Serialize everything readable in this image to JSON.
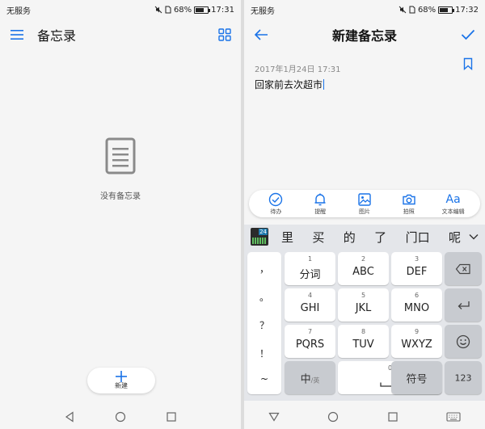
{
  "left_screen": {
    "status": {
      "carrier": "无服务",
      "battery_text": "68%",
      "battery_level": 0.68,
      "time": "17:31"
    },
    "appbar": {
      "title": "备忘录"
    },
    "empty": {
      "text": "没有备忘录"
    },
    "fab": {
      "label": "新建"
    }
  },
  "right_screen": {
    "status": {
      "carrier": "无服务",
      "battery_text": "68%",
      "battery_level": 0.68,
      "time": "17:32"
    },
    "appbar": {
      "title": "新建备忘录"
    },
    "note": {
      "date": "2017年1月24日 17:31",
      "body": "回家前去次超市"
    },
    "toolbar": {
      "items": [
        {
          "label": "待办",
          "icon": "check-circle-icon"
        },
        {
          "label": "提醒",
          "icon": "bell-icon"
        },
        {
          "label": "图片",
          "icon": "image-icon"
        },
        {
          "label": "拍照",
          "icon": "camera-icon"
        },
        {
          "label": "文本编辑",
          "icon": "Aa"
        }
      ]
    },
    "keyboard": {
      "logo_badge": "24",
      "candidates": [
        "里",
        "买",
        "的",
        "了",
        "门口",
        "呢"
      ],
      "punct": [
        "，",
        "。",
        "？",
        "！",
        "~"
      ],
      "keys": [
        {
          "n": "1",
          "l": "分词"
        },
        {
          "n": "2",
          "l": "ABC"
        },
        {
          "n": "3",
          "l": "DEF"
        },
        {
          "n": "4",
          "l": "GHI"
        },
        {
          "n": "5",
          "l": "JKL"
        },
        {
          "n": "6",
          "l": "MNO"
        },
        {
          "n": "7",
          "l": "PQRS"
        },
        {
          "n": "8",
          "l": "TUV"
        },
        {
          "n": "9",
          "l": "WXYZ"
        }
      ],
      "lang_key": "中",
      "lang_sub": "/英",
      "space_num": "0",
      "symbol_key": "符号",
      "num_key": "123"
    }
  },
  "colors": {
    "accent": "#1a73e8",
    "background": "#f5f5f5",
    "keyboard_bg": "#e4e6ea",
    "gray_key": "#c8cbd0"
  }
}
